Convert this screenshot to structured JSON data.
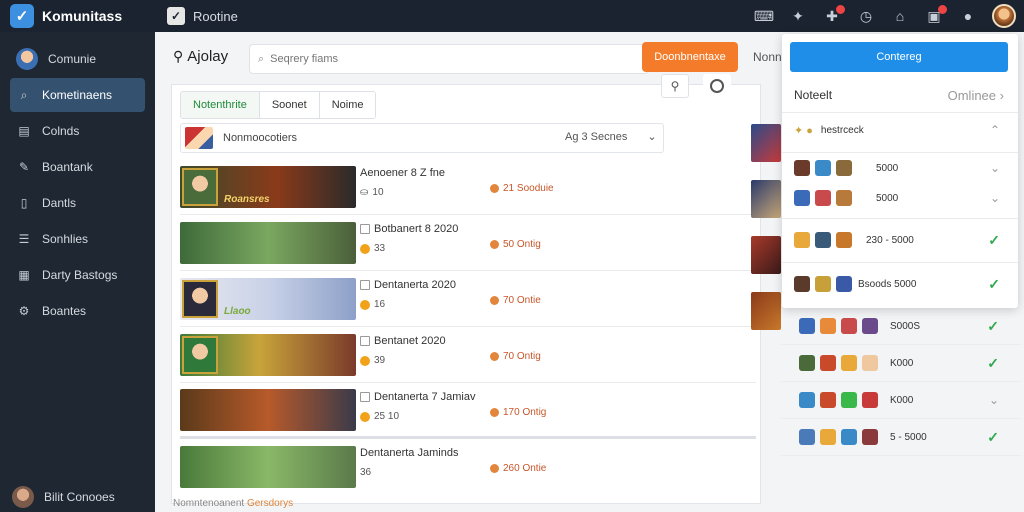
{
  "app": {
    "name": "Komunitass"
  },
  "top_tab": {
    "label": "Rootine"
  },
  "sidebar": {
    "items": [
      {
        "label": "Comunie",
        "icon": "avatar-icon"
      },
      {
        "label": "Kometinaens",
        "icon": "search-icon"
      },
      {
        "label": "Colnds",
        "icon": "folder-icon"
      },
      {
        "label": "Boantank",
        "icon": "edit-icon"
      },
      {
        "label": "Dantls",
        "icon": "document-icon"
      },
      {
        "label": "Sonhlies",
        "icon": "list-icon"
      },
      {
        "label": "Darty Bastogs",
        "icon": "chart-icon"
      },
      {
        "label": "Boantes",
        "icon": "settings-icon"
      }
    ],
    "bottom_label": "Bilit Conooes"
  },
  "header": {
    "title": "Ajolay",
    "search_placeholder": "Seqrery fiams",
    "primary_button": "Doonbnentaxe",
    "link": "Nonne"
  },
  "tabs": [
    {
      "label": "Notenthrite",
      "active": true
    },
    {
      "label": "Soonet",
      "active": false
    },
    {
      "label": "Noime",
      "active": false
    }
  ],
  "filter": {
    "label": "Nonmoocotiers",
    "select_value": "Ag 3 Secnes"
  },
  "games": [
    {
      "banner_text": "Roansres",
      "title": "Aenoener 8 Z fne",
      "meta": "10",
      "stat": "21 Sooduie",
      "colors": [
        "#3b4a2a",
        "#8a3a1a",
        "#2a2a2a"
      ]
    },
    {
      "banner_text": "",
      "title": "Botbanert 8 2020",
      "meta": "33",
      "stat": "50 Ontig",
      "colors": [
        "#3e6a3a",
        "#7aa860",
        "#4b5f3a"
      ]
    },
    {
      "banner_text": "Llaoo",
      "title": "Dentanerta 2020",
      "meta": "16",
      "stat": "70 Ontie",
      "colors": [
        "#e8e8ef",
        "#c9d2e8",
        "#8ea0c8"
      ]
    },
    {
      "banner_text": "",
      "title": "Bentanet 2020",
      "meta": "39",
      "stat": "70 Ontig",
      "colors": [
        "#3a7a3a",
        "#c8a43a",
        "#7a3a2a"
      ]
    },
    {
      "banner_text": "",
      "title": "Dentanerta 7 Jamiav",
      "meta": "25 10",
      "stat": "170 Ontig",
      "colors": [
        "#5a3a1a",
        "#b85a2a",
        "#3a3a4a"
      ]
    },
    {
      "banner_text": "",
      "title": "Dentanerta Jaminds",
      "meta": "36",
      "stat": "260 Ontie",
      "colors": [
        "#4a7a3a",
        "#8ab868",
        "#5a7a4a"
      ]
    }
  ],
  "footer": {
    "prefix": "Nomntenoanent",
    "highlight": "Gersdorys"
  },
  "panel": {
    "button": "Contereg",
    "heading": "Noteelt",
    "status": "Omlinee",
    "rows": [
      {
        "text": "hestrceck",
        "state": "expanded"
      },
      {
        "text": "5000",
        "state": "chevron"
      },
      {
        "text": "5000",
        "state": "chevron"
      },
      {
        "text": "230 - 5000",
        "state": "check"
      },
      {
        "text": "Bsoods 5000",
        "state": "check"
      }
    ]
  },
  "right_list": [
    {
      "text": "S000S",
      "state": "check"
    },
    {
      "text": "K000",
      "state": "check"
    },
    {
      "text": "K000",
      "state": "chevron"
    },
    {
      "text": "5 - 5000",
      "state": "check"
    }
  ],
  "colors": {
    "accent": "#1e8ee8",
    "primary_action": "#f47b2a",
    "sidebar_bg": "#1f2733",
    "success": "#2fa84f"
  }
}
